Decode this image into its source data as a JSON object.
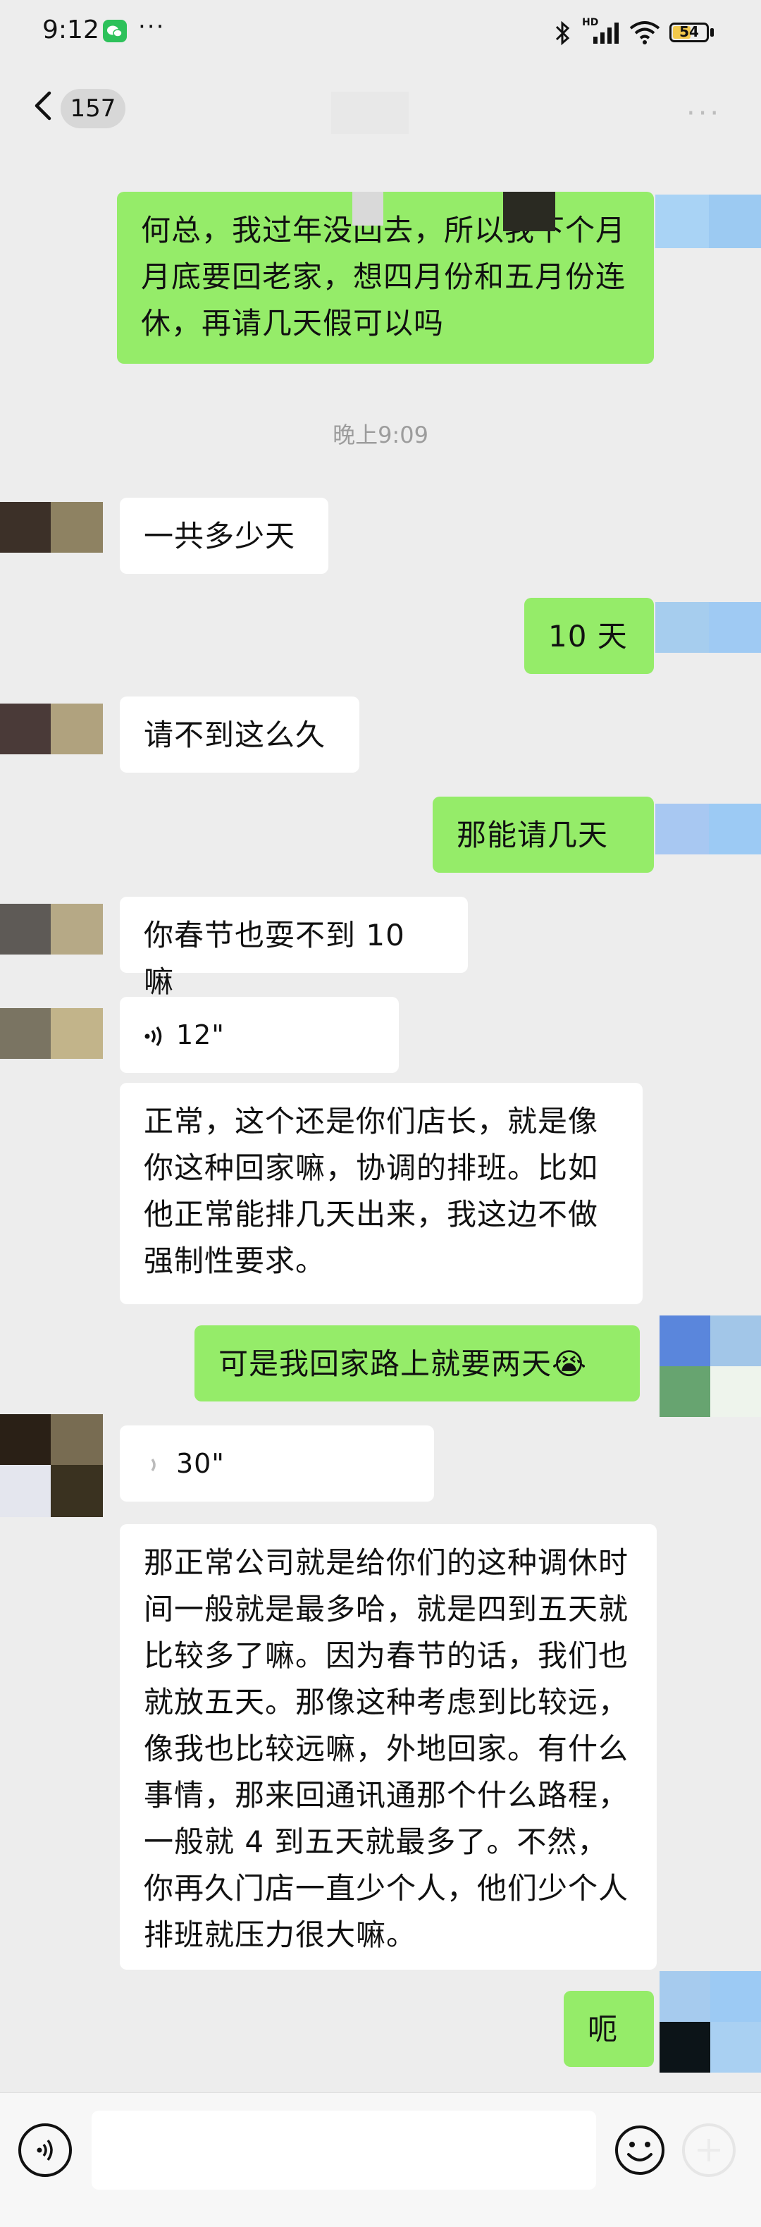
{
  "status_bar": {
    "time": "9:12",
    "dots": "···",
    "network": "HD",
    "battery": "54",
    "battery_level": 0.54
  },
  "nav": {
    "unread_count": "157",
    "more": "···"
  },
  "timestamp": "晚上9:09",
  "messages": [
    {
      "side": "out",
      "text": "何总，我过年没回去，所以我下个月月底要回老家，想四月份和五月份连休，再请几天假可以吗"
    },
    {
      "side": "in",
      "text": "一共多少天"
    },
    {
      "side": "out",
      "text": "10 天"
    },
    {
      "side": "in",
      "text": "请不到这么久"
    },
    {
      "side": "out",
      "text": "那能请几天"
    },
    {
      "side": "in",
      "text": "你春节也耍不到 10 嘛"
    },
    {
      "side": "in",
      "type": "voice",
      "duration": "12\""
    },
    {
      "side": "in",
      "text": "正常，这个还是你们店长，就是像你这种回家嘛，协调的排班。比如他正常能排几天出来，我这边不做强制性要求。"
    },
    {
      "side": "out",
      "text": "可是我回家路上就要两天😭"
    },
    {
      "side": "in",
      "type": "voice",
      "duration": "30\""
    },
    {
      "side": "in",
      "text": "那正常公司就是给你们的这种调休时间一般就是最多哈，就是四到五天就比较多了嘛。因为春节的话，我们也就放五天。那像这种考虑到比较远，像我也比较远嘛，外地回家。有什么事情，那来回通讯通那个什么路程，一般就 4 到五天就最多了。不然，你再久门店一直少个人，他们少个人排班就压力很大嘛。"
    },
    {
      "side": "out",
      "text": "呃"
    }
  ],
  "input": {
    "placeholder": ""
  },
  "colors": {
    "outgoing_bubble": "#95ec69",
    "incoming_bubble": "#ffffff",
    "background": "#ededed"
  }
}
